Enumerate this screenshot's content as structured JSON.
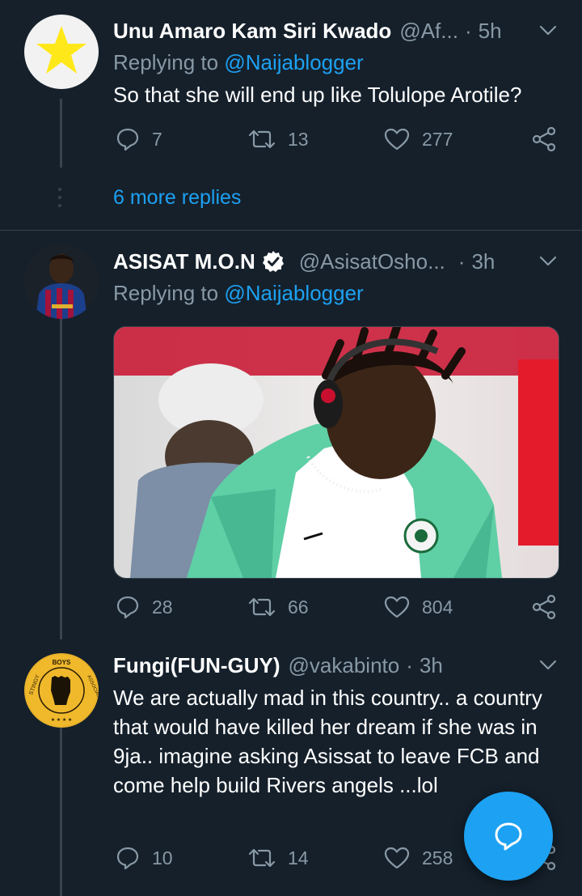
{
  "tweets": [
    {
      "name": "Unu Amaro Kam Siri Kwado",
      "handle": "@Af...",
      "dot": "·",
      "time": "5h",
      "replying_prefix": "Replying to ",
      "replying_to": "@Naijablogger",
      "text": "So that she will end up like Tolulope Arotile?",
      "replies": "7",
      "retweets": "13",
      "likes": "277"
    },
    {
      "name": "ASISAT M.O.N",
      "verified": true,
      "handle": "@AsisatOsho...",
      "dot": "·",
      "time": "3h",
      "replying_prefix": "Replying to ",
      "replying_to": "@Naijablogger",
      "replies": "28",
      "retweets": "66",
      "likes": "804"
    },
    {
      "name": "Fungi(FUN-GUY)",
      "handle": "@vakabinto",
      "dot": "·",
      "time": "3h",
      "text": "We are actually mad in this country.. a country that would have killed her dream if she was in 9ja.. imagine asking Asissat to leave FCB and come help build Rivers angels ...lol",
      "replies": "10",
      "retweets": "14",
      "likes": "258"
    }
  ],
  "thread": {
    "more_replies": "6 more replies"
  },
  "avatar3_text": "STINGY BOYS ASSOCIATION",
  "colors": {
    "background": "#15202b",
    "text_secondary": "#8899a6",
    "accent": "#1da1f2",
    "divider": "#38444d"
  },
  "icons": [
    "chevron-down-icon",
    "reply-icon",
    "retweet-icon",
    "like-icon",
    "share-icon",
    "verified-badge-icon",
    "compose-reply-icon"
  ]
}
